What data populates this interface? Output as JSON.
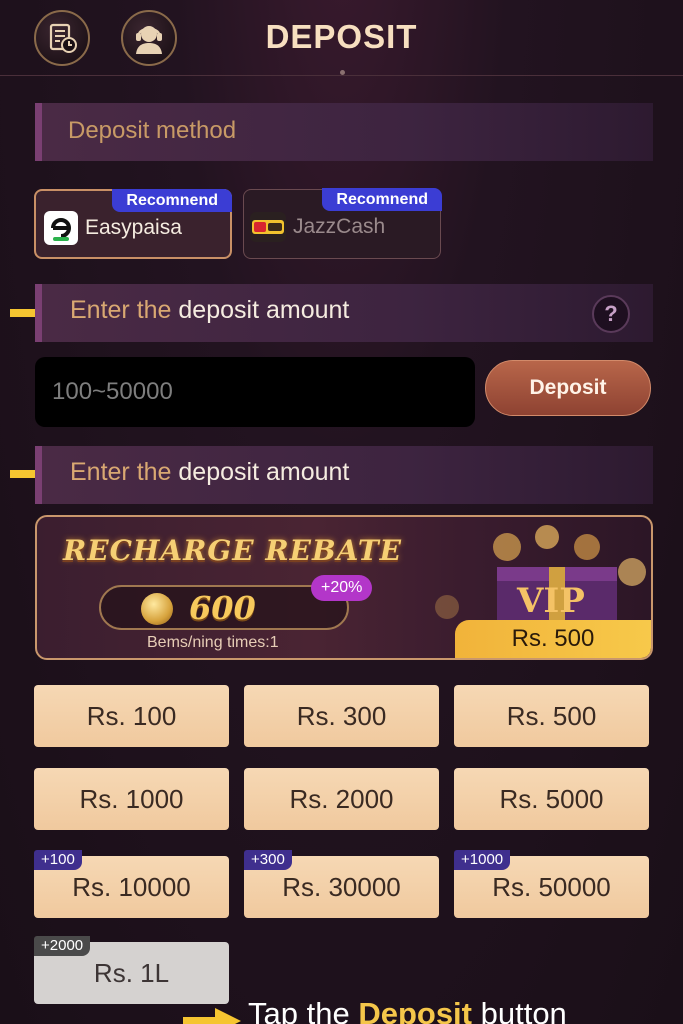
{
  "header": {
    "title": "DEPOSIT"
  },
  "method_section": {
    "label": "Deposit method"
  },
  "methods": [
    {
      "name": "Easypaisa",
      "tag": "Recomnend"
    },
    {
      "name": "JazzCash",
      "tag": "Recomnend"
    }
  ],
  "amount_section": {
    "label_a": "Enter the",
    "label_b": "deposit amount",
    "help": "?"
  },
  "amount_input": {
    "placeholder": "100~50000",
    "value": ""
  },
  "deposit_button": {
    "label": "Deposit"
  },
  "amount_section_2": {
    "label_a": "Enter the",
    "label_b": "deposit amount"
  },
  "banner": {
    "title": "RECHARGE REBATE",
    "coins": "600",
    "bonus_pct": "+20%",
    "note": "Bems/ning times:1",
    "vip": "VIP",
    "price": "Rs. 500"
  },
  "amounts": [
    {
      "label": "Rs. 100",
      "bonus": ""
    },
    {
      "label": "Rs. 300",
      "bonus": ""
    },
    {
      "label": "Rs. 500",
      "bonus": ""
    },
    {
      "label": "Rs. 1000",
      "bonus": ""
    },
    {
      "label": "Rs. 2000",
      "bonus": ""
    },
    {
      "label": "Rs. 5000",
      "bonus": ""
    },
    {
      "label": "Rs. 10000",
      "bonus": "+100"
    },
    {
      "label": "Rs. 30000",
      "bonus": "+300"
    },
    {
      "label": "Rs. 50000",
      "bonus": "+1000"
    },
    {
      "label": "Rs. 1L",
      "bonus": "+2000"
    }
  ],
  "footer_hint": {
    "a": "Tap the ",
    "b": "Deposit",
    "c": " button"
  },
  "colors": {
    "accent_gold": "#f4c64a",
    "tag_blue": "#3b3dd4",
    "pct_purple": "#b336c9",
    "amount_tile": "#f0c99e"
  },
  "icons": [
    "record-icon",
    "support-agent-icon",
    "arrow-pointer-icon",
    "help-icon",
    "coin-icon"
  ]
}
